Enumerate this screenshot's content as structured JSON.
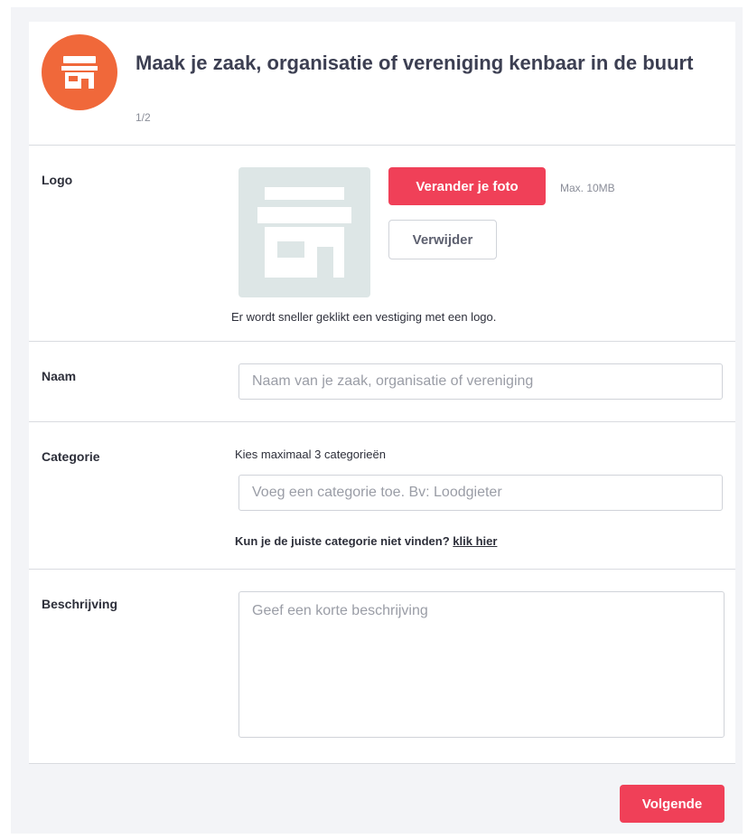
{
  "header": {
    "title": "Maak je zaak, organisatie of vereniging kenbaar in de buurt",
    "step": "1/2",
    "icon": "store-icon",
    "icon_color": "#f0683a"
  },
  "logo": {
    "label": "Logo",
    "change_button": "Verander je foto",
    "max_size": "Max. 10MB",
    "remove_button": "Verwijder",
    "hint": "Er wordt sneller geklikt een vestiging met een logo.",
    "placeholder_icon": "store-icon"
  },
  "naam": {
    "label": "Naam",
    "placeholder": "Naam van je zaak, organisatie of vereniging"
  },
  "categorie": {
    "label": "Categorie",
    "hint": "Kies maximaal 3 categorieën",
    "placeholder": "Voeg een categorie toe. Bv: Loodgieter",
    "help_text": "Kun je de juiste categorie niet vinden?",
    "help_link": "klik hier"
  },
  "beschrijving": {
    "label": "Beschrijving",
    "placeholder": "Geef een korte beschrijving"
  },
  "footer": {
    "next_button": "Volgende"
  },
  "colors": {
    "primary": "#f04058",
    "accent": "#f0683a"
  }
}
